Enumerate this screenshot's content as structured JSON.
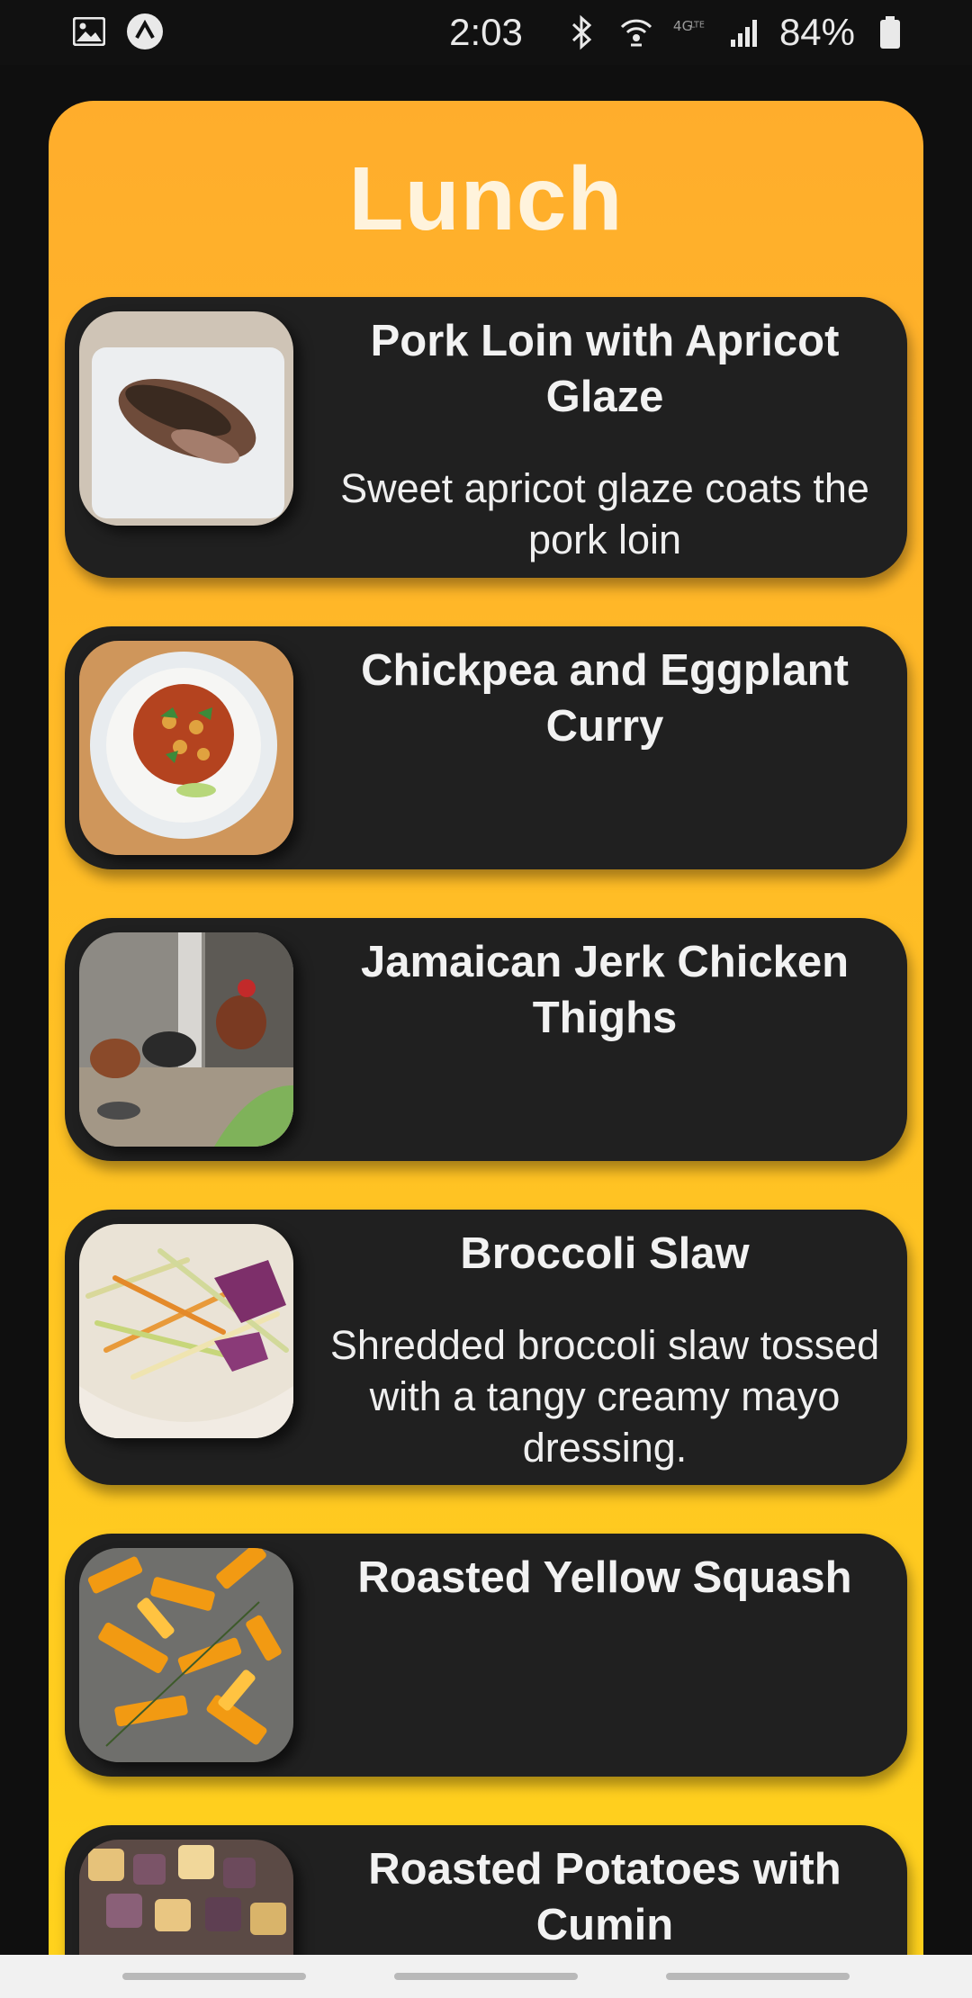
{
  "status_bar": {
    "time": "2:03",
    "battery": "84%",
    "left_icons": [
      "image-icon",
      "arrow-up-circle-icon"
    ],
    "right_icons": [
      "bluetooth-icon",
      "wifi-calling-icon",
      "4g-icon",
      "signal-icon",
      "battery-icon"
    ]
  },
  "screen": {
    "title": "Lunch",
    "accent_gradient": [
      "#ffad2c",
      "#ffd21d"
    ],
    "card_color": "#202020"
  },
  "recipes": [
    {
      "title": "Pork Loin with Apricot Glaze",
      "description": "Sweet apricot glaze coats the pork loin",
      "image": "pork-loin-image"
    },
    {
      "title": "Chickpea and Eggplant Curry",
      "description": "",
      "image": "chickpea-curry-image"
    },
    {
      "title": "Jamaican Jerk Chicken Thighs",
      "description": "",
      "image": "chickens-image"
    },
    {
      "title": "Broccoli Slaw",
      "description": "Shredded broccoli slaw tossed with a tangy creamy mayo dressing.",
      "image": "broccoli-slaw-image"
    },
    {
      "title": "Roasted Yellow Squash",
      "description": "",
      "image": "roasted-squash-image"
    },
    {
      "title": "Roasted Potatoes with Cumin",
      "description": "",
      "image": "roasted-potatoes-image"
    }
  ]
}
